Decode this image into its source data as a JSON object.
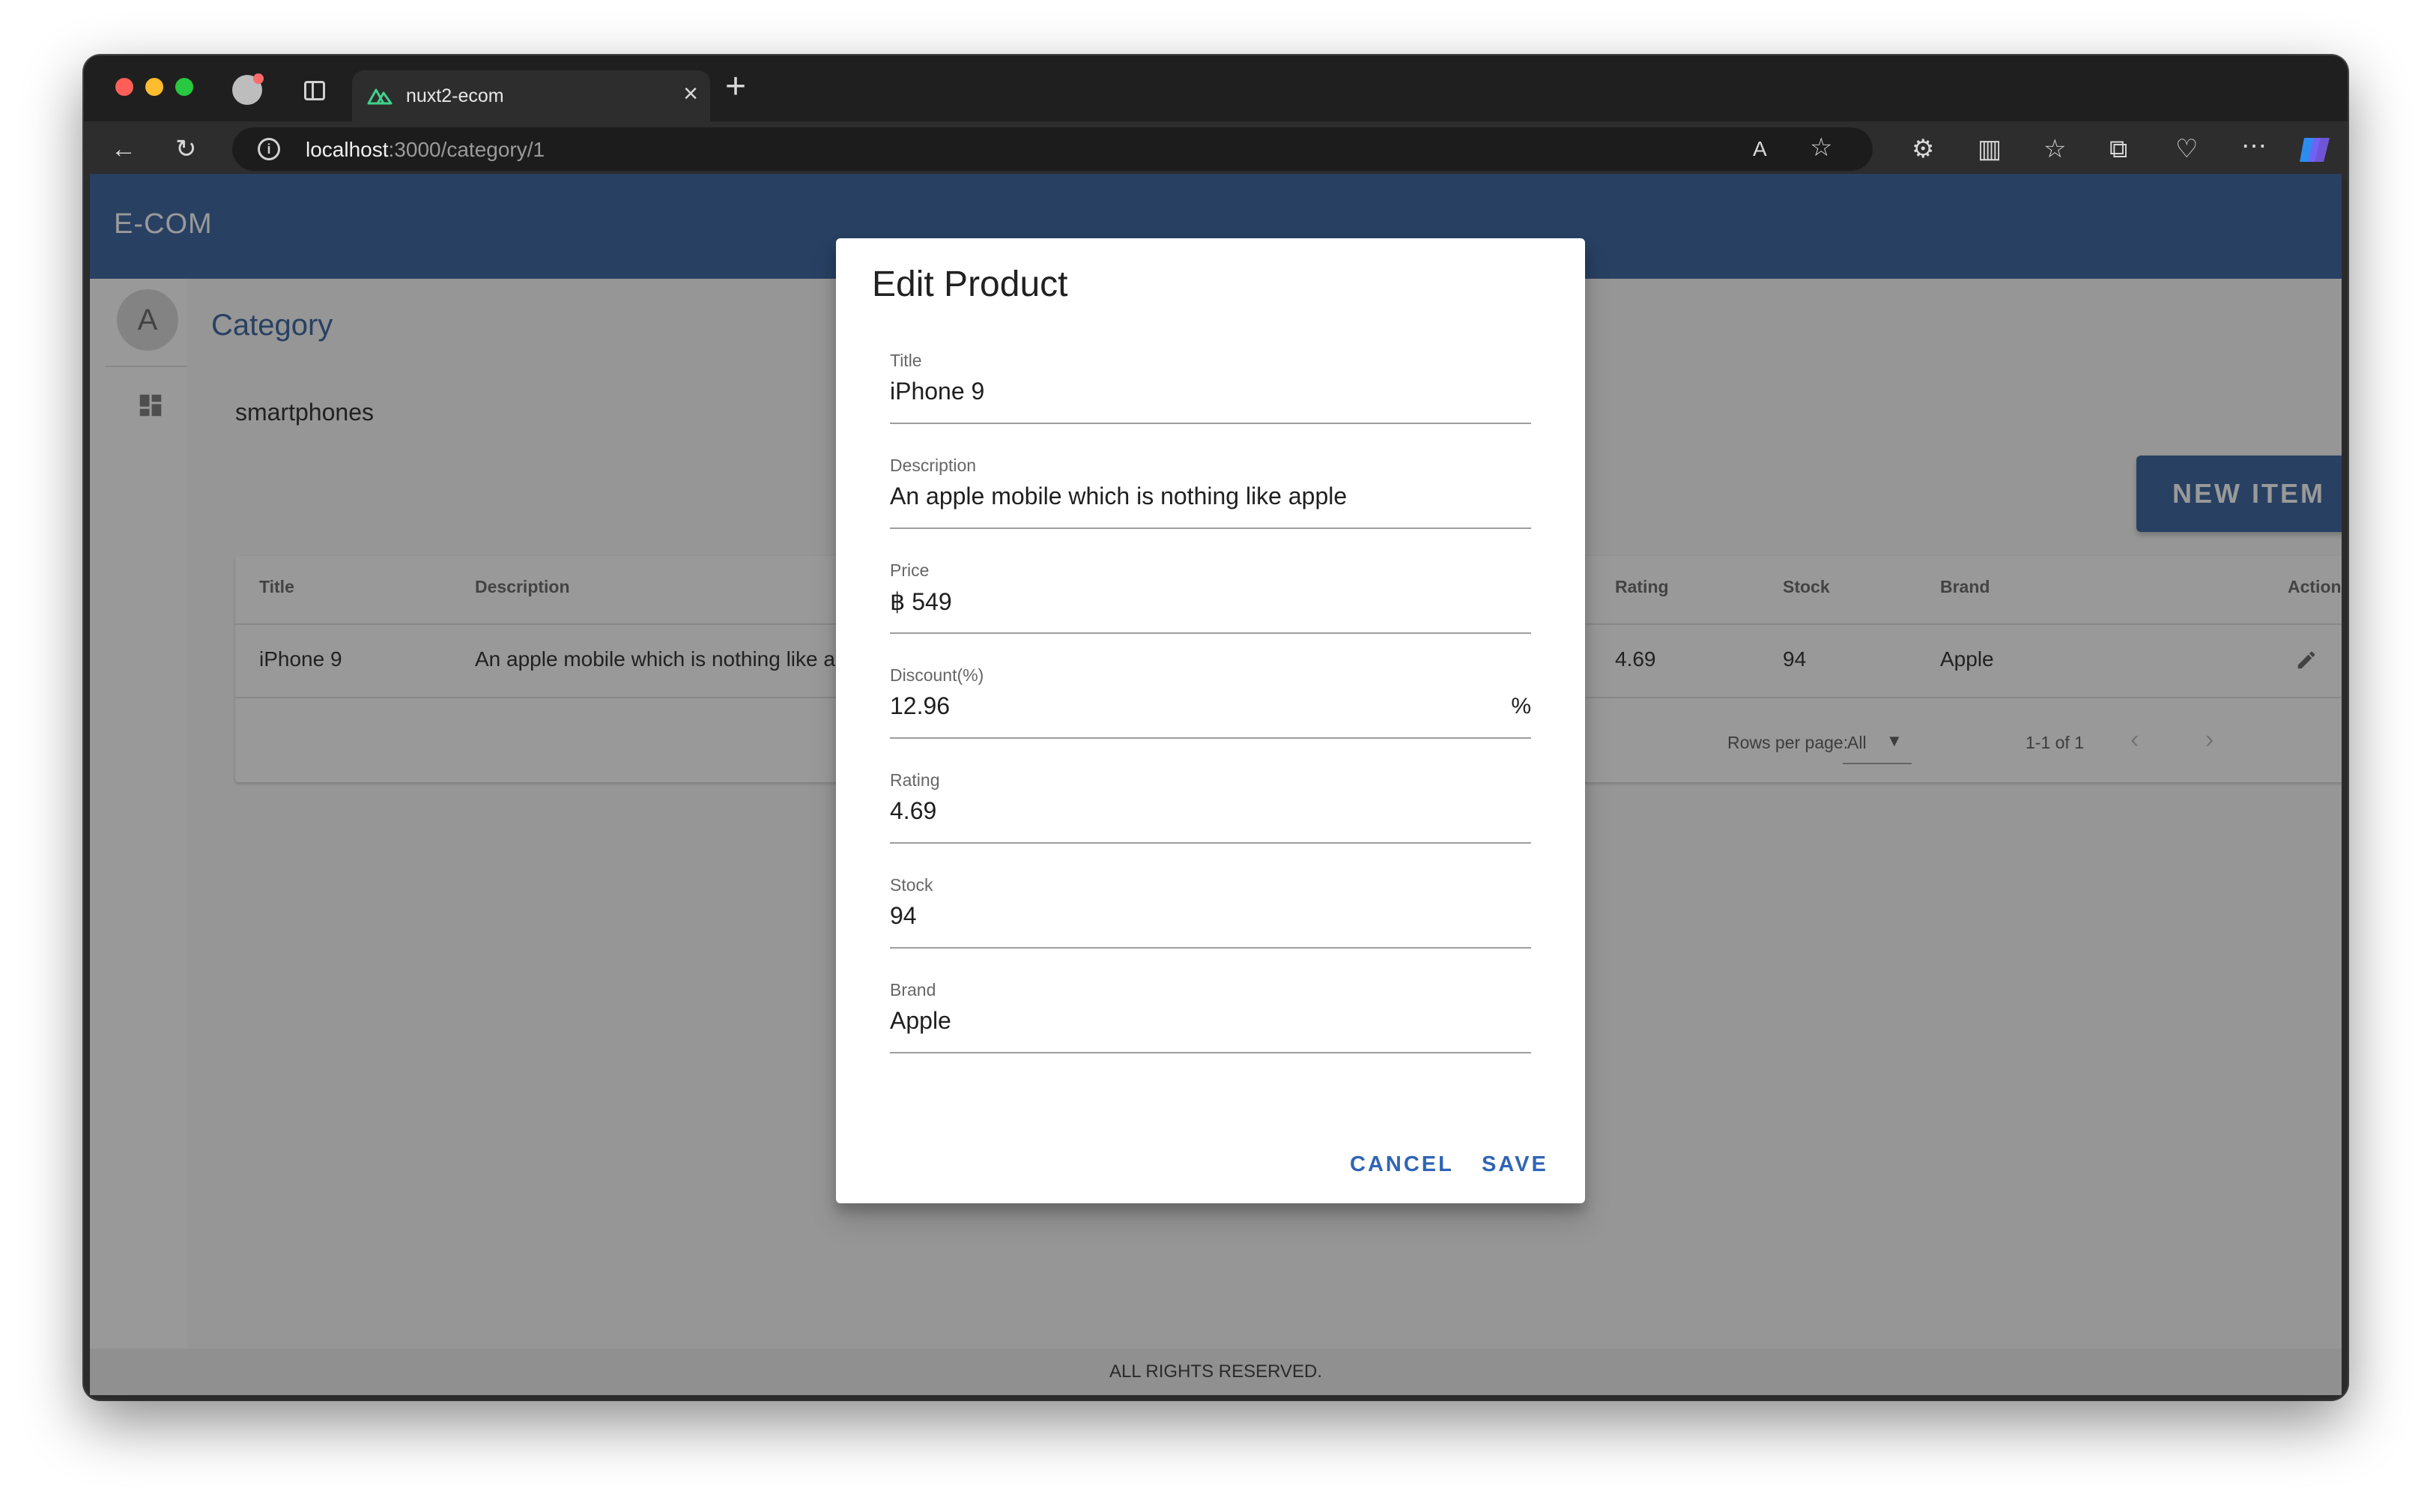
{
  "browser": {
    "tab_title": "nuxt2-ecom",
    "url_host": "localhost",
    "url_path": ":3000/category/1"
  },
  "app": {
    "brand": "E-COM",
    "avatar_letter": "A",
    "page_title": "Category",
    "category_name": "smartphones",
    "new_item_label": "NEW ITEM",
    "footer": "ALL RIGHTS RESERVED."
  },
  "table": {
    "headers": {
      "title": "Title",
      "description": "Description",
      "rating": "Rating",
      "stock": "Stock",
      "brand": "Brand",
      "actions": "Actions"
    },
    "rows": [
      {
        "title": "iPhone 9",
        "description": "An apple mobile which is nothing like ap",
        "rating": "4.69",
        "stock": "94",
        "brand": "Apple"
      }
    ],
    "rows_per_page_label": "Rows per page:",
    "rows_per_page_value": "All",
    "page_info": "1-1 of 1"
  },
  "dialog": {
    "title": "Edit Product",
    "fields": {
      "title": {
        "label": "Title",
        "value": "iPhone 9"
      },
      "description": {
        "label": "Description",
        "value": "An apple mobile which is nothing like apple"
      },
      "price": {
        "label": "Price",
        "value": "฿ 549"
      },
      "discount": {
        "label": "Discount(%)",
        "value": "12.96",
        "suffix": "%"
      },
      "rating": {
        "label": "Rating",
        "value": "4.69"
      },
      "stock": {
        "label": "Stock",
        "value": "94"
      },
      "brand": {
        "label": "Brand",
        "value": "Apple"
      }
    },
    "cancel_label": "CANCEL",
    "save_label": "SAVE"
  },
  "colors": {
    "primary": "#2f5b9a",
    "dialog_button": "#2f65b5"
  }
}
